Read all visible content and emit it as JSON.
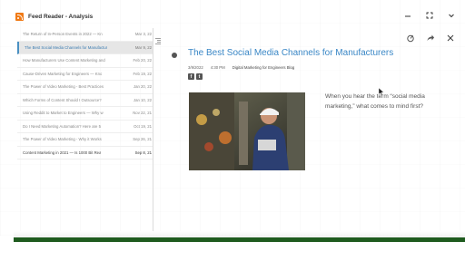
{
  "window": {
    "title": "Feed Reader - Analysis",
    "icon": "rss-icon",
    "controls": [
      "minimize-icon",
      "expand-icon",
      "chevron-down-icon"
    ]
  },
  "articles": [
    {
      "title": "The Return of In-Person Events in 2022 — Kn",
      "date": "Mar 3, 22",
      "state": "read"
    },
    {
      "title": "The Best Social Media Channels for Manufactur",
      "date": "Mar 9, 22",
      "state": "selected"
    },
    {
      "title": "How Manufacturers Use Content Marketing and",
      "date": "Feb 20, 22",
      "state": "read"
    },
    {
      "title": "Cause-Driven Marketing for Engineers — Kno",
      "date": "Feb 19, 22",
      "state": "read"
    },
    {
      "title": "The Power of Video Marketing - Best Practices",
      "date": "Jan 20, 22",
      "state": "read"
    },
    {
      "title": "Which Forms of Content Should I Outsource?",
      "date": "Jan 10, 22",
      "state": "read"
    },
    {
      "title": "Using Reddit to Market to Engineers — Why w",
      "date": "Nov 22, 21",
      "state": "read"
    },
    {
      "title": "Do I Need Marketing Automation? Here are 5",
      "date": "Oct 19, 21",
      "state": "read"
    },
    {
      "title": "The Power of Video Marketing - Why it Works",
      "date": "Sep 26, 21",
      "state": "read"
    },
    {
      "title": "Content Marketing in 2021 — Is 1000 Bit Rea",
      "date": "Sep 8, 21",
      "state": "unread"
    }
  ],
  "reader": {
    "title": "The Best Social Media Channels for Manufacturers",
    "date": "3/9/2022",
    "time": "4:30 PM",
    "source": "Digital Marketing for Engineers Blog",
    "share_icons": [
      "facebook-icon",
      "twitter-icon"
    ],
    "tools": [
      "settings-icon",
      "share-icon",
      "close-icon"
    ],
    "body": "When you hear the term “social media marketing,” what comes to mind first?"
  },
  "colors": {
    "accent": "#3a87c6",
    "selected_bg": "#e6e6e6",
    "app_icon": "#f07a16",
    "bottom_bar": "#1f5b1f"
  }
}
